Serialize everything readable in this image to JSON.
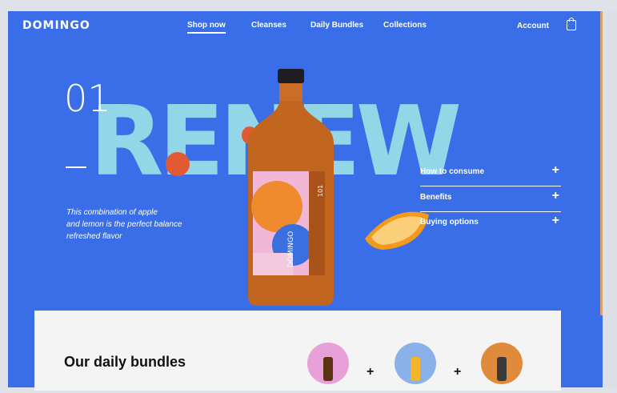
{
  "header": {
    "logo": "DOMINGO",
    "nav": [
      {
        "label": "Shop now",
        "active": true
      },
      {
        "label": "Cleanses",
        "active": false
      },
      {
        "label": "Daily Bundles",
        "active": false
      },
      {
        "label": "Collections",
        "active": false
      }
    ],
    "account": "Account",
    "bag_icon": "shopping-bag-icon"
  },
  "hero": {
    "number": "01",
    "headline": "RENEW",
    "description_lines": [
      "This combination of apple",
      "and lemon is the perfect balance",
      "refreshed flavor"
    ],
    "bottle_label_text": "DOMINGO",
    "bottle_side_text": "101",
    "accordion": [
      {
        "label": "How to consume"
      },
      {
        "label": "Benefits"
      },
      {
        "label": "Buying options"
      }
    ]
  },
  "bundles": {
    "title": "Our daily bundles",
    "plus": "+",
    "circles": [
      {
        "color": "#e8a0d8"
      },
      {
        "color": "#8ab2e8"
      },
      {
        "color": "#e08a3c"
      }
    ]
  },
  "colors": {
    "background": "#3a6ee8",
    "headline": "#93d6e8",
    "bottle": "#c2661f",
    "fruit": "#e25a34"
  }
}
